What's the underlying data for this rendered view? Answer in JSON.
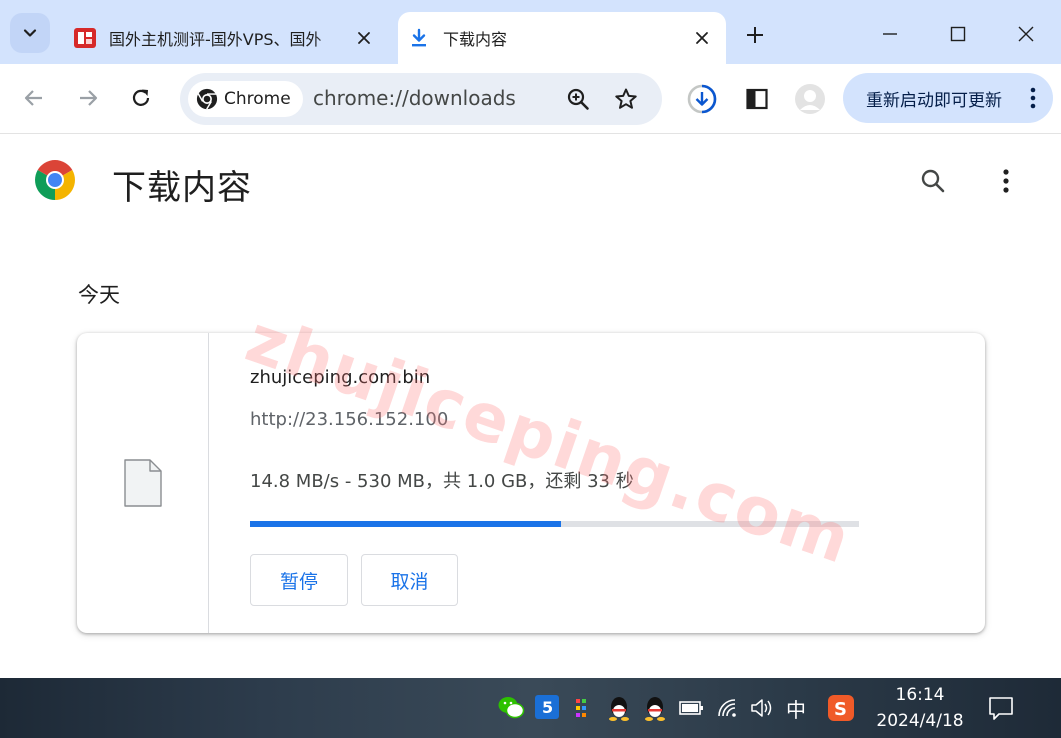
{
  "tabs": [
    {
      "title": "国外主机测评-国外VPS、国外",
      "state": "inactive"
    },
    {
      "title": "下载内容",
      "state": "active"
    }
  ],
  "toolbar": {
    "chip_label": "Chrome",
    "url": "chrome://downloads",
    "update_label": "重新启动即可更新"
  },
  "page": {
    "title": "下载内容",
    "date_heading": "今天"
  },
  "download": {
    "filename": "zhujiceping.com.bin",
    "url": "http://23.156.152.100",
    "status": "14.8 MB/s - 530 MB，共 1.0 GB，还剩 33 秒",
    "progress_fraction": 0.51,
    "pause_label": "暂停",
    "cancel_label": "取消"
  },
  "watermark": "zhujiceping.com",
  "taskbar": {
    "ime_label": "中",
    "time": "16:14",
    "date": "2024/4/18"
  },
  "colors": {
    "tabstrip_bg": "#d3e3fd",
    "omnibox_bg": "#e9eef6",
    "accent": "#1a73e8",
    "progress_track": "#dfe1e5"
  }
}
